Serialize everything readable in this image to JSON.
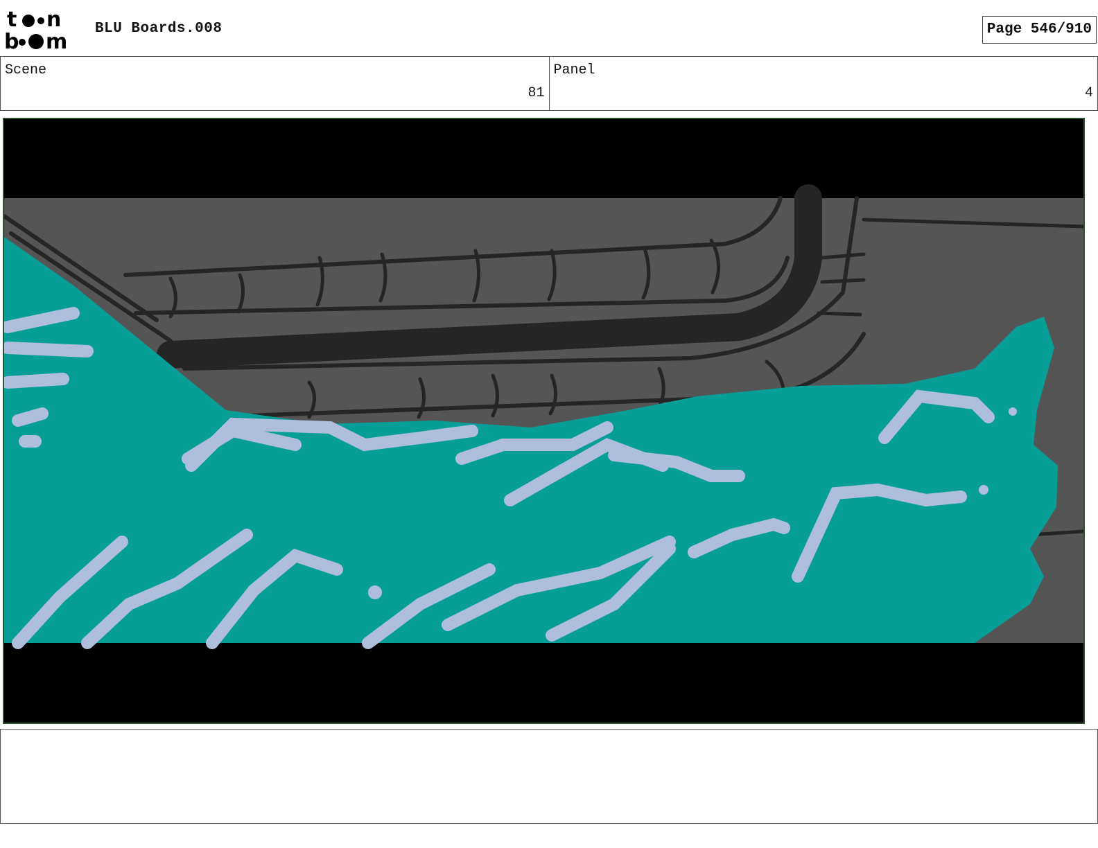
{
  "header": {
    "logo_text": "toon boom",
    "document_title": "BLU Boards.008",
    "page_indicator": "Page 546/910"
  },
  "info": {
    "scene_label": "Scene",
    "scene_value": "81",
    "panel_label": "Panel",
    "panel_value": "4"
  },
  "panel_image": {
    "icon": "storyboard-sketch-wave-over-rail",
    "colors": {
      "letterbox": "#000000",
      "background": "#555555",
      "rail_ink": "#252525",
      "wave": "#079e98",
      "foam": "#b0bede"
    }
  },
  "notes": {
    "text": ""
  }
}
